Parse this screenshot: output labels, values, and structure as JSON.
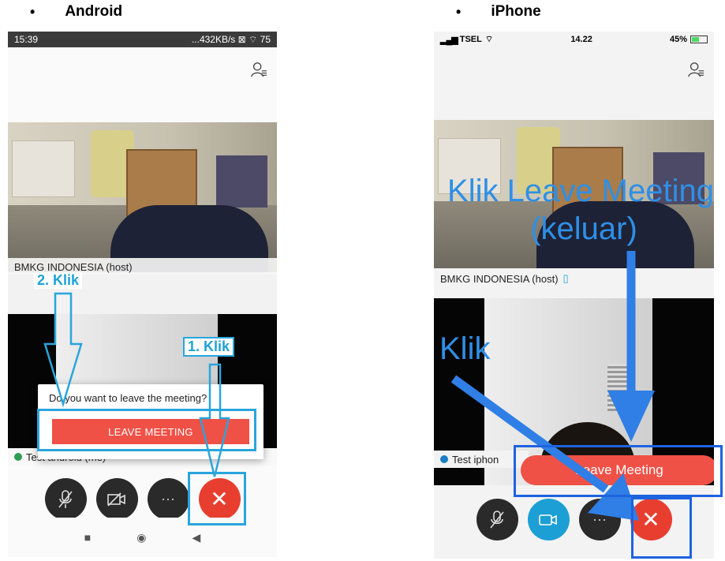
{
  "headings": {
    "android": "Android",
    "iphone": "iPhone",
    "bullet": "•"
  },
  "android": {
    "status_time": "15:39",
    "status_right": "...432KB/s ⊠ ⌔ 75",
    "host_name": "BMKG INDONESIA (host)",
    "self_name": "Test android (me)",
    "dialog_text": "Do you want to leave the meeting?",
    "leave_label": "LEAVE MEETING",
    "annot_step2": "2. Klik",
    "annot_step1": "1. Klik",
    "controls": {
      "mute_icon": "mic-off-icon",
      "video_icon": "video-off-icon",
      "more_label": "···",
      "end_label": "✕"
    },
    "nav": {
      "recent": "■",
      "home": "◉",
      "back": "◀"
    }
  },
  "iphone": {
    "status_carrier": "TSEL",
    "status_time": "14.22",
    "status_battery": "45%",
    "host_name": "BMKG INDONESIA (host)",
    "self_name": "Test iphon",
    "leave_label": "Leave Meeting",
    "annot_top_line1": "Klik Leave Meeting",
    "annot_top_line2": "(keluar)",
    "annot_klik": "Klik",
    "controls": {
      "more_label": "···",
      "end_label": "✕"
    }
  },
  "colors": {
    "leave_red": "#f05146",
    "end_red": "#e83e2f",
    "annot_cyan": "#29a5dd",
    "annot_blue": "#1e63e0",
    "video_on_blue": "#1c9fd5"
  }
}
